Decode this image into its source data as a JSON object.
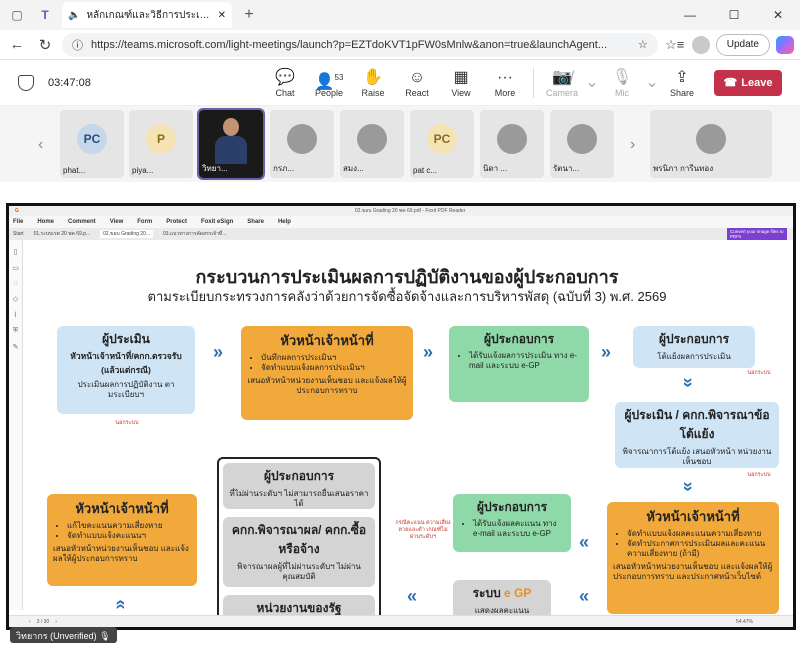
{
  "browser": {
    "tab_title": "หลักเกณฑ์และวิธีการประเมินผลกา",
    "url": "https://teams.microsoft.com/light-meetings/launch?p=EZTdoKVT1pFW0sMnlw&anon=true&launchAgent...",
    "update_label": "Update"
  },
  "meeting": {
    "timer": "03:47:08",
    "controls": [
      {
        "label": "Chat",
        "icon": "chat-icon",
        "glyph": "💬"
      },
      {
        "label": "People",
        "icon": "people-icon",
        "glyph": "👤",
        "badge": "53"
      },
      {
        "label": "Raise",
        "icon": "raise-hand-icon",
        "glyph": "✋"
      },
      {
        "label": "React",
        "icon": "react-icon",
        "glyph": "☺"
      },
      {
        "label": "View",
        "icon": "view-icon",
        "glyph": "▦"
      },
      {
        "label": "More",
        "icon": "more-icon",
        "glyph": "···"
      }
    ],
    "camera_label": "Camera",
    "mic_label": "Mic",
    "share_label": "Share",
    "leave_label": "Leave",
    "people_count": "53"
  },
  "participants": [
    {
      "initials": "PC",
      "name": "phat...",
      "color": "#c5d7ea"
    },
    {
      "initials": "P",
      "name": "piya...",
      "color": "#f6e3b4"
    },
    {
      "initials": "",
      "name": "วิทยา...",
      "speaker": true
    },
    {
      "initials": "",
      "name": "กรภ...",
      "color": "#9a9a9a"
    },
    {
      "initials": "",
      "name": "สมง...",
      "color": "#9a9a9a"
    },
    {
      "initials": "PC",
      "name": "pat c...",
      "color": "#f6e3b4"
    },
    {
      "initials": "",
      "name": "นิดา ...",
      "color": "#9a9a9a"
    },
    {
      "initials": "",
      "name": "รัตนา...",
      "color": "#9a9a9a"
    },
    {
      "initials": "",
      "name": "พรนิภา การีนทอง",
      "color": "#9a9a9a"
    }
  ],
  "pdf": {
    "window_title": "02.ขอบ Grading 20 พค 69.pdf - Foxit PDF Reader",
    "menu": [
      "File",
      "Home",
      "Comment",
      "View",
      "Form",
      "Protect",
      "Foxit eSign",
      "Share",
      "Help"
    ],
    "tabs": [
      "Start",
      "01.ระบบเรต 20 พค 69.p...",
      "02.ขอบ Grading 20...",
      "03.แนวทางการคัดสรรเจ้าที่..."
    ],
    "convert_label": "Convert your image files to PDFs",
    "page_indicator": "3 / 30",
    "zoom": "54.47%"
  },
  "slide": {
    "title": "กระบวนการประเมินผลการปฏิบัติงานของผู้ประกอบการ",
    "subtitle": "ตามระเบียบกระทรวงการคลังว่าด้วยการจัดซื้อจัดจ้างและการบริหารพัสดุ (ฉบับที่ 3) พ.ศ. 2569",
    "box1": {
      "title": "ผู้ประเมิน",
      "sub": "หัวหน้าเจ้าหน้าที่/คกก.ตรวจรับ (แล้วแต่กรณี)",
      "text": "ประเมินผลการปฏิบัติงาน ตามระเบียบฯ"
    },
    "box2": {
      "title": "หัวหน้าเจ้าหน้าที่",
      "items": [
        "บันทึกผลการประเมินฯ",
        "จัดทำแบบแจ้งผลการประเมินฯ"
      ],
      "text": "เสนอหัวหน้าหน่วยงานเห็นชอบ และแจ้งผลให้ผู้ประกอบการทราบ"
    },
    "box3": {
      "title": "ผู้ประกอบการ",
      "items": [
        "ได้รับแจ้งผลการประเมิน ทาง e-mail และระบบ e-GP"
      ]
    },
    "box4": {
      "title": "ผู้ประกอบการ",
      "text": "โต้แย้งผลการประเมิน"
    },
    "box5": {
      "title": "ผู้ประเมิน / คกก.พิจารณาข้อโต้แย้ง",
      "text": "พิจารณาการโต้แย้ง เสนอหัวหน้า หน่วยงานเห็นชอบ"
    },
    "box6": {
      "title": "หัวหน้าเจ้าหน้าที่",
      "items": [
        "จัดทำแบบแจ้งผลคะแนนความเสี่ยงหาย",
        "จัดทำประกาศการประเมินผลและคะแนนความเสี่ยงหาย (ถ้ามี)"
      ],
      "text": "เสนอหัวหน้าหน่วยงานเห็นชอบ และแจ้งผลให้ผู้ประกอบการทราบ และประกาศหน้าเว็บไซต์"
    },
    "box7": {
      "title": "ผู้ประกอบการ",
      "items": [
        "ได้รับแจ้งผลคะแนน ทาง e-mail และระบบ e-GP"
      ]
    },
    "box8": {
      "title": "หัวหน้าเจ้าหน้าที่",
      "items": [
        "แก้ไขคะแนนความเสี่ยงหาย",
        "จัดทำแบบแจ้งคะแนนฯ"
      ],
      "text": "เสนอหัวหน้าหน่วยงานเห็นชอบ และแจ้งผลให้ผู้ประกอบการทราบ"
    },
    "framed1": {
      "title": "ผู้ประกอบการ",
      "text": "ที่ไม่ผ่านระดับฯ ไม่สามารถยื่นเสนอราคาได้"
    },
    "framed2": {
      "title": "คกก.พิจารณาผล/ คกก.ซื้อหรือจ้าง",
      "text": "พิจารณาผลผู้ที่ไม่ผ่านระดับฯ ไม่ผ่านคุณสมบัติ"
    },
    "framed3": {
      "title": "หน่วยงานของรัฐ"
    },
    "egp": {
      "title": "ระบบ",
      "logo": "e GP",
      "text": "แสดงผลคะแนน"
    },
    "note1": "นอกระบบ",
    "note2": "นอกระบบ",
    "note3": "นอกระบบ",
    "note4": "กรณีคะแนน ความเสี่ยงหายและตำ เกณฑ์ไม่ผ่านระดับฯ"
  },
  "speaker_label": "วิทยากร (Unverified)"
}
